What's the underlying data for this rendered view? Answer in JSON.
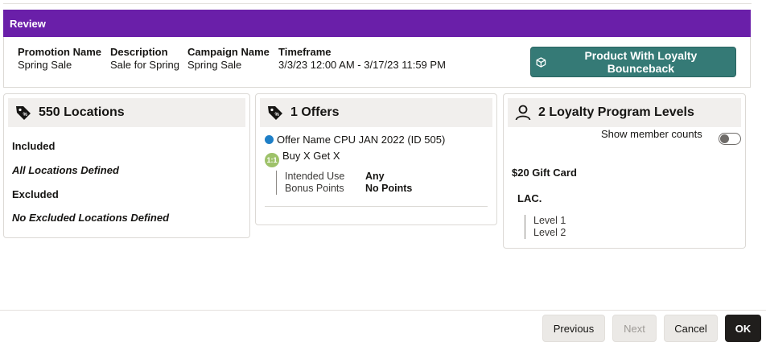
{
  "header": {
    "title": "Review"
  },
  "summary": {
    "promotion_name_label": "Promotion Name",
    "promotion_name_value": "Spring Sale",
    "description_label": "Description",
    "description_value": "Sale for Spring",
    "campaign_name_label": "Campaign Name",
    "campaign_name_value": "Spring Sale",
    "timeframe_label": "Timeframe",
    "timeframe_value": "3/3/23 12:00 AM - 3/17/23 11:59 PM",
    "action_button_label": "Product With Loyalty Bounceback"
  },
  "locations": {
    "title": "550 Locations",
    "included_label": "Included",
    "included_value": "All Locations Defined",
    "excluded_label": "Excluded",
    "excluded_value": "No Excluded Locations Defined"
  },
  "offers": {
    "title": "1 Offers",
    "offer_name": "Offer Name CPU JAN 2022 (ID 505)",
    "offer_type": "Buy X Get X",
    "intended_use_label": "Intended Use",
    "intended_use_value": "Any",
    "bonus_points_label": "Bonus Points",
    "bonus_points_value": "No Points"
  },
  "loyalty": {
    "title": "2 Loyalty Program Levels",
    "show_member_counts_label": "Show member counts",
    "show_member_counts_on": false,
    "reward": "$20 Gift Card",
    "program": "LAC.",
    "levels": [
      "Level 1",
      "Level 2"
    ]
  },
  "footer": {
    "previous_label": "Previous",
    "next_label": "Next",
    "cancel_label": "Cancel",
    "ok_label": "OK"
  },
  "colors": {
    "header_bg": "#6a1fa9",
    "action_button_bg": "#357a76",
    "ok_button_bg": "#201e1c",
    "offer_dot": "#1e7fc7",
    "buyx_icon": "#9ec26a"
  }
}
